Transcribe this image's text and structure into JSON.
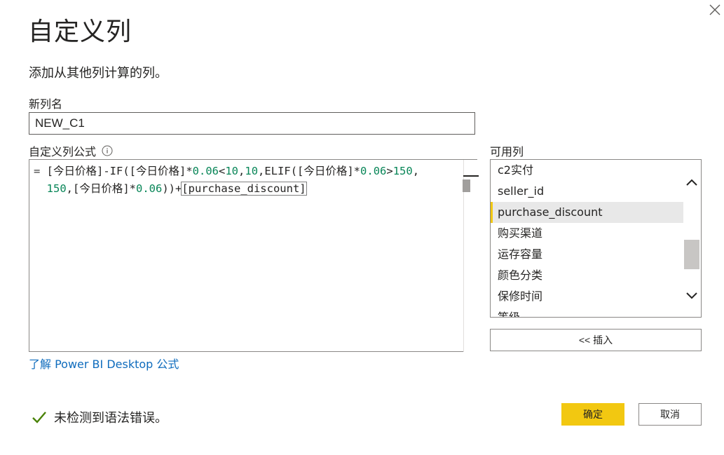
{
  "dialog": {
    "title": "自定义列",
    "subtitle": "添加从其他列计算的列。",
    "close_icon": "close-icon"
  },
  "new_column": {
    "label": "新列名",
    "value": "NEW_C1"
  },
  "formula": {
    "label": "自定义列公式",
    "info_icon": "info-icon",
    "line1": {
      "eq": "= ",
      "p1": "[今日价格]-IF([今日价格]*",
      "n1": "0.06",
      "p2": "<",
      "n2": "10",
      "p3": ",",
      "n3": "10",
      "p4": ",ELIF([今日价格]*",
      "n4": "0.06",
      "p5": ">",
      "n5": "150",
      "p6": ","
    },
    "line2": {
      "n1": "150",
      "p1": ",[今日价格]*",
      "n2": "0.06",
      "p2": "))+",
      "hl": "[purchase_discount]"
    }
  },
  "available_columns": {
    "label": "可用列",
    "items": [
      "c2实付",
      "seller_id",
      "purchase_discount",
      "购买渠道",
      "运存容量",
      "颜色分类",
      "保修时间",
      "等级"
    ],
    "selected": "purchase_discount",
    "accent_color": "#f2c811"
  },
  "insert_button": {
    "label": "<< 插入"
  },
  "learn_link": {
    "label": "了解 Power BI Desktop 公式"
  },
  "status": {
    "icon": "checkmark-icon",
    "text": "未检测到语法错误。",
    "color": "#498205"
  },
  "buttons": {
    "ok": "确定",
    "cancel": "取消",
    "ok_color": "#f2c811"
  }
}
